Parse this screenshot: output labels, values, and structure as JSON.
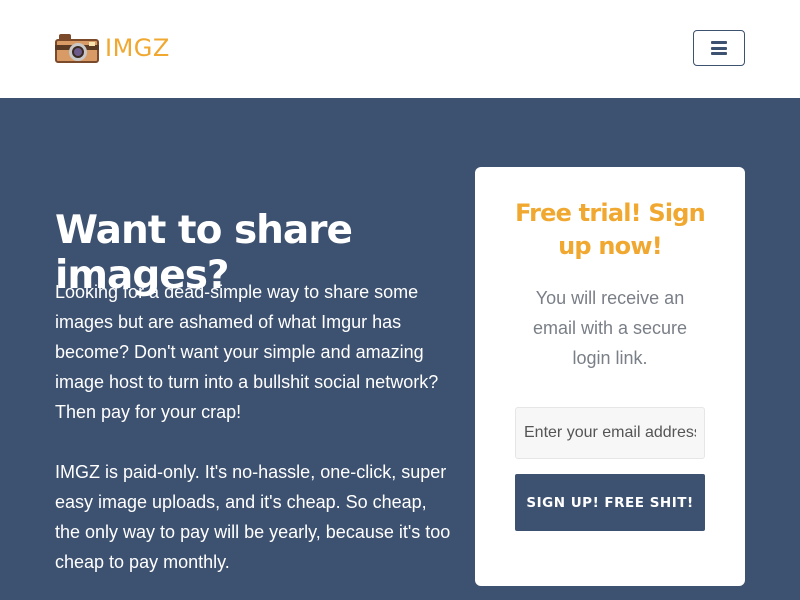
{
  "header": {
    "brand_name": "IMGZ",
    "logo_icon": "camera-icon",
    "menu_icon": "hamburger-icon"
  },
  "hero": {
    "title": "Want to share images?",
    "paragraph1": "Looking for a dead-simple way to share some images but are ashamed of what Imgur has become? Don't want your simple and amazing image host to turn into a bullshit social network? Then pay for your crap!",
    "paragraph2": "IMGZ is paid-only. It's no-hassle, one-click, super easy image uploads, and it's cheap. So cheap, the only way to pay will be yearly, because it's too cheap to pay monthly."
  },
  "signup": {
    "title": "Free trial! Sign up now!",
    "text": "You will receive an email with a secure login link.",
    "email_placeholder": "Enter your email address",
    "email_value": "",
    "button_label": "SIGN UP! FREE SHIT!"
  },
  "colors": {
    "accent": "#f0a830",
    "navy": "#3d5170",
    "white": "#ffffff",
    "muted_text": "#7a7f87"
  }
}
